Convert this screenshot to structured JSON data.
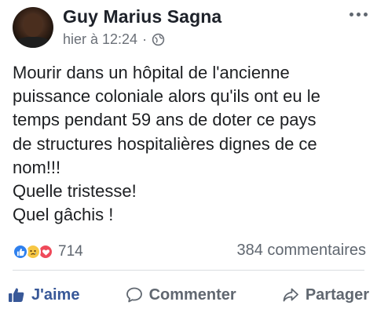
{
  "post": {
    "author": "Guy Marius Sagna",
    "timestamp": "hier à 12:24",
    "separator": "·",
    "privacy_icon": "globe-icon",
    "more_icon": "more-options-icon",
    "text_lines": [
      "Mourir dans un hôpital de l'ancienne",
      "puissance coloniale alors qu'ils ont eu le",
      "temps pendant 59 ans de doter ce pays",
      "de structures hospitalières dignes de ce",
      "nom!!!",
      "Quelle tristesse!",
      "Quel gâchis !"
    ]
  },
  "stats": {
    "reactions": [
      "like-icon",
      "sad-icon",
      "love-icon"
    ],
    "reaction_count": "714",
    "comments_count": "384 commentaires"
  },
  "actions": {
    "like_label": "J'aime",
    "comment_label": "Commenter",
    "share_label": "Partager"
  },
  "colors": {
    "like_blue": "#385898",
    "text": "#1c1e21",
    "secondary_text": "#606770"
  }
}
